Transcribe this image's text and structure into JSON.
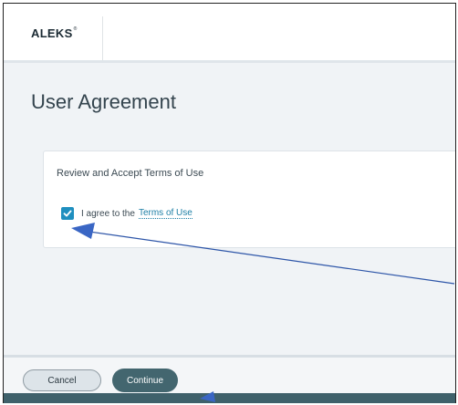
{
  "header": {
    "logo_text": "ALEKS",
    "logo_mark": "®"
  },
  "main": {
    "title": "User Agreement",
    "card": {
      "title": "Review and Accept Terms of Use",
      "agree_prefix": "I agree to the",
      "terms_link": "Terms of Use",
      "checked": true
    }
  },
  "footer": {
    "cancel_label": "Cancel",
    "continue_label": "Continue"
  },
  "annotations": {
    "arrow_color": "#2d55a8"
  }
}
